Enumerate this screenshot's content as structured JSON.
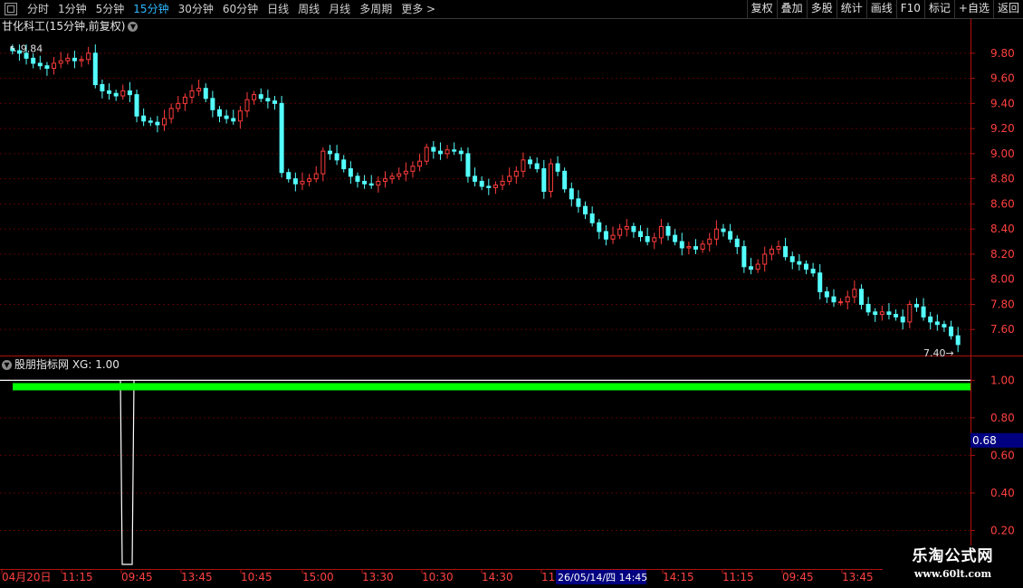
{
  "toolbar": {
    "periods": [
      {
        "label": "分时",
        "active": false
      },
      {
        "label": "1分钟",
        "active": false
      },
      {
        "label": "5分钟",
        "active": false
      },
      {
        "label": "15分钟",
        "active": true
      },
      {
        "label": "30分钟",
        "active": false
      },
      {
        "label": "60分钟",
        "active": false
      },
      {
        "label": "日线",
        "active": false
      },
      {
        "label": "周线",
        "active": false
      },
      {
        "label": "月线",
        "active": false
      },
      {
        "label": "多周期",
        "active": false
      },
      {
        "label": "更多 >",
        "active": false
      }
    ],
    "tools": [
      "复权",
      "叠加",
      "多股",
      "统计",
      "画线",
      "F10",
      "标记",
      "+自选",
      "返回"
    ]
  },
  "main_chart": {
    "title": "甘化科工(15分钟,前复权)",
    "y_ticks": [
      "9.80",
      "9.60",
      "9.40",
      "9.20",
      "9.00",
      "8.80",
      "8.60",
      "8.40",
      "8.20",
      "8.00",
      "7.80",
      "7.60"
    ],
    "high_label": "9.84",
    "low_label": "7.40"
  },
  "indicator": {
    "title": "股朋指标网 XG: 1.00",
    "y_ticks": [
      "1.00",
      "0.80",
      "0.60",
      "0.40",
      "0.20"
    ],
    "current_value": "0.68"
  },
  "x_axis": {
    "labels": [
      "04月20日",
      "11:15",
      "09:45",
      "13:45",
      "10:45",
      "15:00",
      "13:30",
      "10:30",
      "14:30",
      "11:",
      "14:15",
      "11:15",
      "09:45",
      "13:45"
    ],
    "cursor_label": "26/05/14/四 14:45"
  },
  "watermark": {
    "line1": "乐淘公式网",
    "line2": "www.60lt.com"
  },
  "colors": {
    "up": "#ff3c3c",
    "down": "#54ffff",
    "signal": "#00ff00",
    "axis": "#b01010",
    "grid": "#5a0000",
    "cursor_bg": "#000080"
  },
  "chart_data": {
    "type": "candlestick",
    "title": "甘化科工(15分钟,前复权)",
    "y_range": [
      7.4,
      9.95
    ],
    "high": 9.84,
    "low": 7.4,
    "close_path": [
      9.82,
      9.8,
      9.76,
      9.72,
      9.7,
      9.68,
      9.72,
      9.74,
      9.76,
      9.74,
      9.75,
      9.8,
      9.55,
      9.5,
      9.48,
      9.46,
      9.5,
      9.47,
      9.3,
      9.26,
      9.25,
      9.23,
      9.28,
      9.36,
      9.4,
      9.45,
      9.5,
      9.52,
      9.44,
      9.35,
      9.3,
      9.28,
      9.26,
      9.34,
      9.43,
      9.47,
      9.44,
      9.42,
      9.4,
      8.85,
      8.8,
      8.76,
      8.78,
      8.8,
      8.84,
      9.02,
      9.0,
      8.95,
      8.88,
      8.82,
      8.78,
      8.76,
      8.75,
      8.78,
      8.8,
      8.82,
      8.84,
      8.86,
      8.9,
      8.94,
      9.05,
      9.02,
      9.0,
      9.03,
      9.02,
      9.0,
      8.82,
      8.78,
      8.74,
      8.73,
      8.75,
      8.78,
      8.82,
      8.86,
      8.95,
      8.92,
      8.88,
      8.7,
      8.92,
      8.86,
      8.72,
      8.64,
      8.58,
      8.52,
      8.45,
      8.38,
      8.32,
      8.35,
      8.4,
      8.42,
      8.38,
      8.34,
      8.3,
      8.33,
      8.42,
      8.35,
      8.3,
      8.25,
      8.26,
      8.24,
      8.28,
      8.32,
      8.4,
      8.38,
      8.32,
      8.26,
      8.1,
      8.08,
      8.12,
      8.2,
      8.24,
      8.26,
      8.18,
      8.14,
      8.12,
      8.08,
      8.05,
      7.9,
      7.86,
      7.82,
      7.82,
      7.86,
      7.92,
      7.8,
      7.74,
      7.72,
      7.74,
      7.72,
      7.7,
      7.66,
      7.8,
      7.78,
      7.7,
      7.66,
      7.64,
      7.62,
      7.55,
      7.48
    ],
    "indicator": {
      "name": "XG",
      "y_range": [
        0.0,
        1.05
      ],
      "value_path": [
        1,
        1,
        1,
        1,
        0.02,
        0.02,
        1,
        1,
        1,
        1,
        1,
        1
      ],
      "last_value": 1.0
    }
  }
}
